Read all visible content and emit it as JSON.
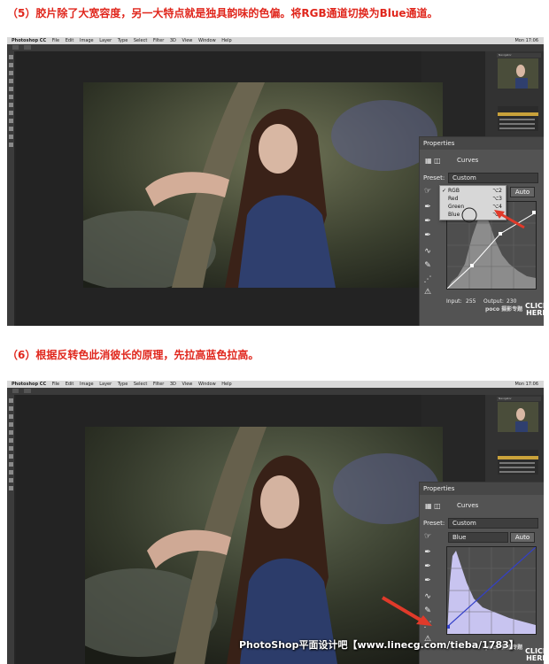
{
  "step5": {
    "caption": "（5）胶片除了大宽容度，另一大特点就是独具韵味的色偏。将RGB通道切换为Blue通道。",
    "curves": {
      "panel_title": "Properties",
      "adjustment_title": "Curves",
      "preset_label": "Preset:",
      "preset_value": "Custom",
      "auto_label": "Auto",
      "channel_menu": [
        {
          "label": "RGB",
          "shortcut": "⌥2",
          "checked": true
        },
        {
          "label": "Red",
          "shortcut": "⌥3",
          "checked": false
        },
        {
          "label": "Green",
          "shortcut": "⌥4",
          "checked": false
        },
        {
          "label": "Blue",
          "shortcut": "⌥5",
          "checked": false
        }
      ],
      "input_label": "Input:",
      "input_value": "255",
      "output_label": "Output:",
      "output_value": "230"
    }
  },
  "step6": {
    "caption": "（6）根据反转色此消彼长的原理，先拉高蓝色拉高。",
    "curves": {
      "panel_title": "Properties",
      "adjustment_title": "Curves",
      "preset_label": "Preset:",
      "preset_value": "Custom",
      "channel_value": "Blue",
      "auto_label": "Auto"
    }
  },
  "photoshop": {
    "app_name": "Photoshop CC",
    "menus": [
      "File",
      "Edit",
      "Image",
      "Layer",
      "Type",
      "Select",
      "Filter",
      "3D",
      "View",
      "Window",
      "Help"
    ],
    "clock": "Mon 17:06",
    "navigator_title": "Navigator"
  },
  "branding": {
    "poco": "poco 摄影专题",
    "click_here": [
      "CLICK",
      "HERE"
    ],
    "watermark": "PhotoShop平面设计吧【www.linecg.com/tieba/1783】"
  },
  "colors": {
    "caption": "#e0261c",
    "accent_arrow": "#e03a2a",
    "selected_layer": "#c9a23a"
  }
}
